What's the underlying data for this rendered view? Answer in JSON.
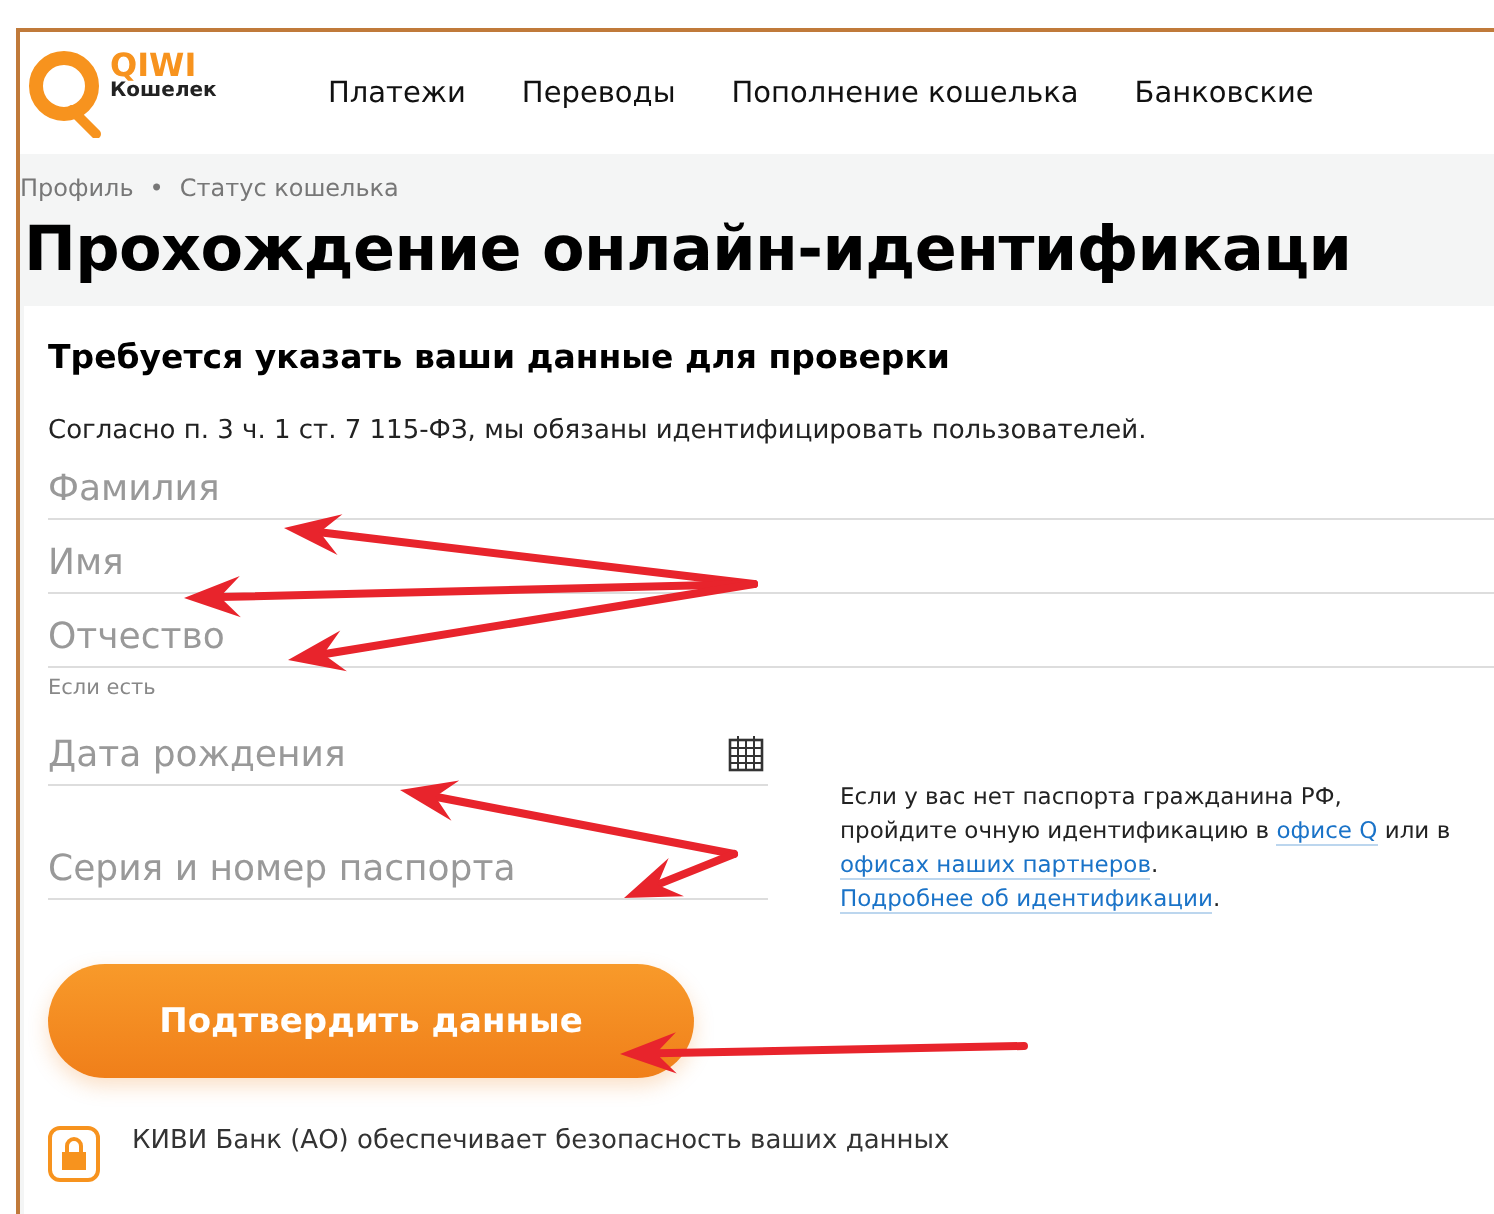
{
  "header": {
    "logo": {
      "brand": "QIWI",
      "subtitle": "Кошелек"
    },
    "nav": [
      {
        "label": "Платежи"
      },
      {
        "label": "Переводы"
      },
      {
        "label": "Пополнение кошелька"
      },
      {
        "label": "Банковские"
      }
    ]
  },
  "breadcrumbs": [
    {
      "label": "Профиль"
    },
    {
      "label": "•"
    },
    {
      "label": "Статус кошелька"
    }
  ],
  "title": "Прохождение онлайн-идентификаци",
  "form": {
    "heading": "Требуется указать ваши данные для проверки",
    "legal_note": "Согласно п. 3 ч. 1 ст. 7 115-ФЗ, мы обязаны идентифицировать пользователей.",
    "name_fields": [
      {
        "placeholder": "Фамилия"
      },
      {
        "placeholder": "Имя"
      },
      {
        "placeholder": "Отчество",
        "hint": "Если есть"
      }
    ],
    "id_fields": [
      {
        "placeholder": "Дата рождения",
        "kind": "date"
      },
      {
        "placeholder": "Серия и номер паспорта",
        "kind": "text"
      }
    ],
    "info": [
      {
        "kind": "plain",
        "text": "Если у вас нет паспорта гражданина РФ,"
      },
      {
        "kind": "plain",
        "text": "пройдите очную идентификацию в"
      },
      {
        "kind": "link",
        "text": "офисе Q"
      },
      {
        "kind": "plain",
        "text": "или в"
      },
      {
        "kind": "link",
        "text": "офисах наших партнеров"
      },
      {
        "kind": "plain",
        "text": "."
      },
      {
        "kind": "link",
        "text": "Подробнее об идентификации"
      },
      {
        "kind": "plain",
        "text": "."
      }
    ],
    "submit": "Подтвердить данные",
    "security_note": "КИВИ Банк (АО) обеспечивает безопасность ваших данных"
  }
}
